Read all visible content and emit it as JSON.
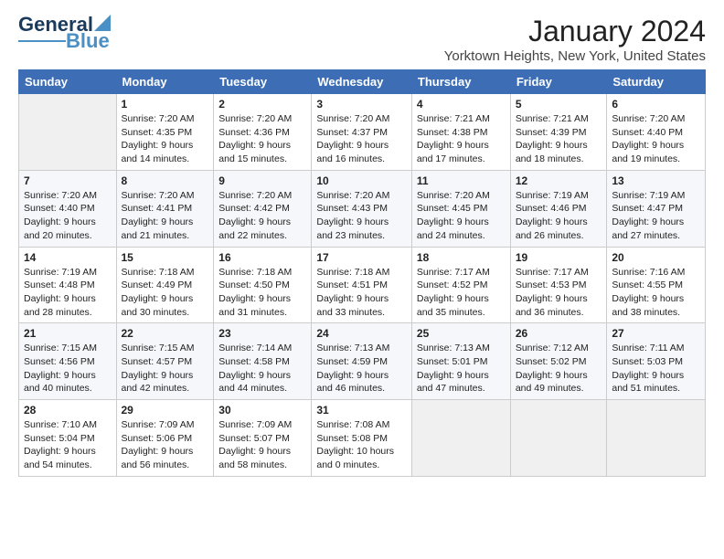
{
  "header": {
    "logo_general": "General",
    "logo_blue": "Blue",
    "month_title": "January 2024",
    "location": "Yorktown Heights, New York, United States"
  },
  "days_of_week": [
    "Sunday",
    "Monday",
    "Tuesday",
    "Wednesday",
    "Thursday",
    "Friday",
    "Saturday"
  ],
  "weeks": [
    [
      {
        "day": "",
        "content": ""
      },
      {
        "day": "1",
        "content": "Sunrise: 7:20 AM\nSunset: 4:35 PM\nDaylight: 9 hours\nand 14 minutes."
      },
      {
        "day": "2",
        "content": "Sunrise: 7:20 AM\nSunset: 4:36 PM\nDaylight: 9 hours\nand 15 minutes."
      },
      {
        "day": "3",
        "content": "Sunrise: 7:20 AM\nSunset: 4:37 PM\nDaylight: 9 hours\nand 16 minutes."
      },
      {
        "day": "4",
        "content": "Sunrise: 7:21 AM\nSunset: 4:38 PM\nDaylight: 9 hours\nand 17 minutes."
      },
      {
        "day": "5",
        "content": "Sunrise: 7:21 AM\nSunset: 4:39 PM\nDaylight: 9 hours\nand 18 minutes."
      },
      {
        "day": "6",
        "content": "Sunrise: 7:20 AM\nSunset: 4:40 PM\nDaylight: 9 hours\nand 19 minutes."
      }
    ],
    [
      {
        "day": "7",
        "content": ""
      },
      {
        "day": "8",
        "content": "Sunrise: 7:20 AM\nSunset: 4:41 PM\nDaylight: 9 hours\nand 21 minutes."
      },
      {
        "day": "9",
        "content": "Sunrise: 7:20 AM\nSunset: 4:42 PM\nDaylight: 9 hours\nand 22 minutes."
      },
      {
        "day": "10",
        "content": "Sunrise: 7:20 AM\nSunset: 4:43 PM\nDaylight: 9 hours\nand 23 minutes."
      },
      {
        "day": "11",
        "content": "Sunrise: 7:20 AM\nSunset: 4:45 PM\nDaylight: 9 hours\nand 24 minutes."
      },
      {
        "day": "12",
        "content": "Sunrise: 7:19 AM\nSunset: 4:46 PM\nDaylight: 9 hours\nand 26 minutes."
      },
      {
        "day": "13",
        "content": "Sunrise: 7:19 AM\nSunset: 4:47 PM\nDaylight: 9 hours\nand 27 minutes."
      }
    ],
    [
      {
        "day": "14",
        "content": ""
      },
      {
        "day": "15",
        "content": "Sunrise: 7:18 AM\nSunset: 4:49 PM\nDaylight: 9 hours\nand 30 minutes."
      },
      {
        "day": "16",
        "content": "Sunrise: 7:18 AM\nSunset: 4:50 PM\nDaylight: 9 hours\nand 31 minutes."
      },
      {
        "day": "17",
        "content": "Sunrise: 7:18 AM\nSunset: 4:51 PM\nDaylight: 9 hours\nand 33 minutes."
      },
      {
        "day": "18",
        "content": "Sunrise: 7:17 AM\nSunset: 4:52 PM\nDaylight: 9 hours\nand 35 minutes."
      },
      {
        "day": "19",
        "content": "Sunrise: 7:17 AM\nSunset: 4:53 PM\nDaylight: 9 hours\nand 36 minutes."
      },
      {
        "day": "20",
        "content": "Sunrise: 7:16 AM\nSunset: 4:55 PM\nDaylight: 9 hours\nand 38 minutes."
      }
    ],
    [
      {
        "day": "21",
        "content": ""
      },
      {
        "day": "22",
        "content": "Sunrise: 7:15 AM\nSunset: 4:57 PM\nDaylight: 9 hours\nand 42 minutes."
      },
      {
        "day": "23",
        "content": "Sunrise: 7:14 AM\nSunset: 4:58 PM\nDaylight: 9 hours\nand 44 minutes."
      },
      {
        "day": "24",
        "content": "Sunrise: 7:13 AM\nSunset: 4:59 PM\nDaylight: 9 hours\nand 46 minutes."
      },
      {
        "day": "25",
        "content": "Sunrise: 7:13 AM\nSunset: 5:01 PM\nDaylight: 9 hours\nand 47 minutes."
      },
      {
        "day": "26",
        "content": "Sunrise: 7:12 AM\nSunset: 5:02 PM\nDaylight: 9 hours\nand 49 minutes."
      },
      {
        "day": "27",
        "content": "Sunrise: 7:11 AM\nSunset: 5:03 PM\nDaylight: 9 hours\nand 51 minutes."
      }
    ],
    [
      {
        "day": "28",
        "content": "Sunrise: 7:10 AM\nSunset: 5:04 PM\nDaylight: 9 hours\nand 54 minutes."
      },
      {
        "day": "29",
        "content": "Sunrise: 7:09 AM\nSunset: 5:06 PM\nDaylight: 9 hours\nand 56 minutes."
      },
      {
        "day": "30",
        "content": "Sunrise: 7:09 AM\nSunset: 5:07 PM\nDaylight: 9 hours\nand 58 minutes."
      },
      {
        "day": "31",
        "content": "Sunrise: 7:08 AM\nSunset: 5:08 PM\nDaylight: 10 hours\nand 0 minutes."
      },
      {
        "day": "",
        "content": ""
      },
      {
        "day": "",
        "content": ""
      },
      {
        "day": "",
        "content": ""
      }
    ]
  ],
  "week1_sunday": "Sunrise: 7:20 AM\nSunset: 4:40 PM\nDaylight: 9 hours\nand 20 minutes.",
  "week2_sunday_content": "Sunrise: 7:20 AM\nSunset: 4:40 PM\nDaylight: 9 hours\nand 20 minutes.",
  "week3_sunday_content": "Sunrise: 7:19 AM\nSunset: 4:48 PM\nDaylight: 9 hours\nand 28 minutes.",
  "week4_sunday_content": "Sunrise: 7:15 AM\nSunset: 4:56 PM\nDaylight: 9 hours\nand 40 minutes."
}
